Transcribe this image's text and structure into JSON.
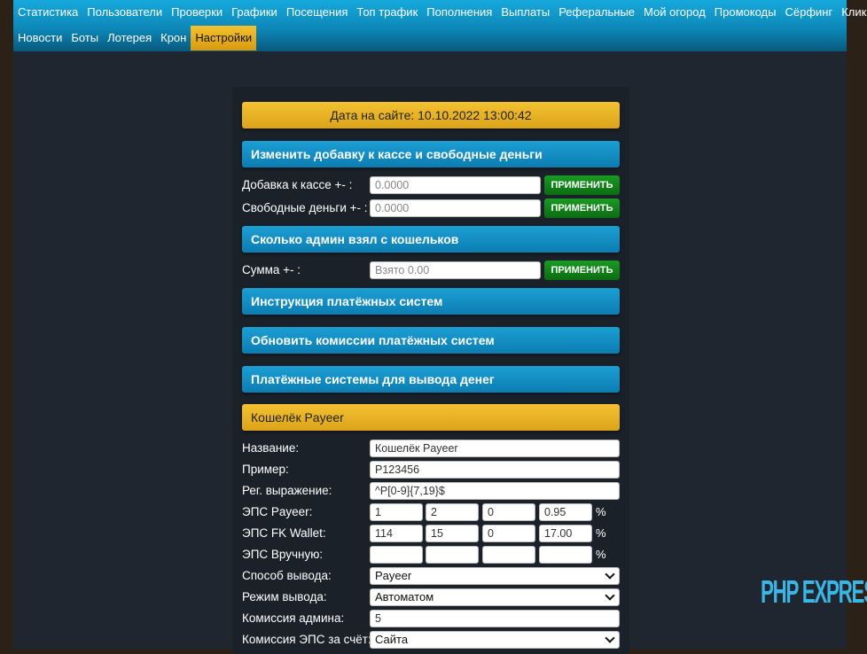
{
  "nav": {
    "row1": [
      "Статистика",
      "Пользователи",
      "Проверки",
      "Графики",
      "Посещения",
      "Топ трафик",
      "Пополнения",
      "Выплаты",
      "Реферальные",
      "Мой огород",
      "Промокоды",
      "Сёрфинг",
      "Клики"
    ],
    "row2": [
      "Новости",
      "Боты",
      "Лотерея",
      "Крон"
    ],
    "active": "Настройки"
  },
  "site_date": "Дата на сайте: 10.10.2022 13:00:42",
  "section_cash": {
    "title": "Изменить добавку к кассе и свободные деньги",
    "cash_label": "Добавка к кассе +- :",
    "cash_value": "0.0000",
    "free_label": "Свободные деньги +- :",
    "free_value": "0.0000",
    "apply": "применить"
  },
  "section_admin": {
    "title": "Сколько админ взял с кошельков",
    "sum_label": "Сумма +- :",
    "sum_placeholder": "Взято 0.00",
    "apply": "применить"
  },
  "section_instructions": "Инструкция платёжных систем",
  "section_update": "Обновить комиссии платёжных систем",
  "section_withdraw": "Платёжные системы для вывода денег",
  "wallet": {
    "title": "Кошелёк Payeer",
    "name_label": "Название:",
    "name_value": "Кошелёк Payeer",
    "example_label": "Пример:",
    "example_value": "P123456",
    "regex_label": "Рег. выражение:",
    "regex_value": "^P[0-9]{7,19}$",
    "eps_payeer_label": "ЭПС Payeer:",
    "eps_payeer": [
      "1",
      "2",
      "0",
      "0.95"
    ],
    "eps_fk_label": "ЭПС FK Wallet:",
    "eps_fk": [
      "114",
      "15",
      "0",
      "17.00"
    ],
    "eps_manual_label": "ЭПС Вручную:",
    "eps_manual": [
      "",
      "",
      "",
      ""
    ],
    "percent": "%",
    "method_label": "Способ вывода:",
    "method_value": "Payeer",
    "mode_label": "Режим вывода:",
    "mode_value": "Автоматом",
    "admin_fee_label": "Комиссия админа:",
    "admin_fee_value": "5",
    "eps_fee_label": "Комиссия ЭПС за счёт:",
    "eps_fee_value": "Сайта"
  },
  "logo_text": "PHP EXPRESS"
}
